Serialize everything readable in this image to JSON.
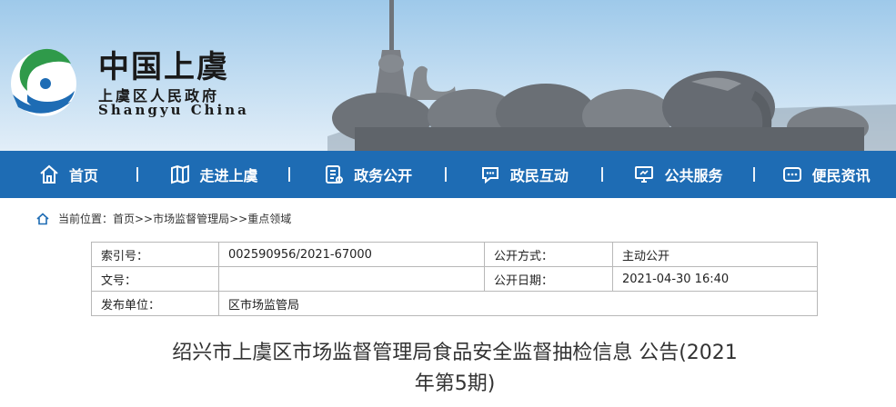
{
  "header": {
    "logo_title": "中国上虞",
    "logo_subtitle": "上虞区人民政府",
    "logo_english": "Shangyu China"
  },
  "nav": {
    "items": [
      {
        "label": "首页",
        "icon": "home-icon"
      },
      {
        "label": "走进上虞",
        "icon": "map-icon"
      },
      {
        "label": "政务公开",
        "icon": "document-icon"
      },
      {
        "label": "政民互动",
        "icon": "chat-icon"
      },
      {
        "label": "公共服务",
        "icon": "monitor-icon"
      },
      {
        "label": "便民资讯",
        "icon": "message-icon"
      }
    ]
  },
  "breadcrumb": {
    "text": "当前位置：首页>>市场监督管理局>>重点领域"
  },
  "meta": {
    "index_label": "索引号：",
    "index_value": "002590956/2021-67000",
    "method_label": "公开方式：",
    "method_value": "主动公开",
    "doc_label": "文号：",
    "doc_value": "",
    "date_label": "公开日期：",
    "date_value": "2021-04-30 16:40",
    "unit_label": "发布单位：",
    "unit_value": "区市场监管局"
  },
  "article": {
    "title_line1": "绍兴市上虞区市场监督管理局食品安全监督抽检信息 公告(2021",
    "title_line2": "年第5期)"
  },
  "colors": {
    "nav_bg": "#1e6cb4",
    "sky": "#b8d7ef"
  }
}
